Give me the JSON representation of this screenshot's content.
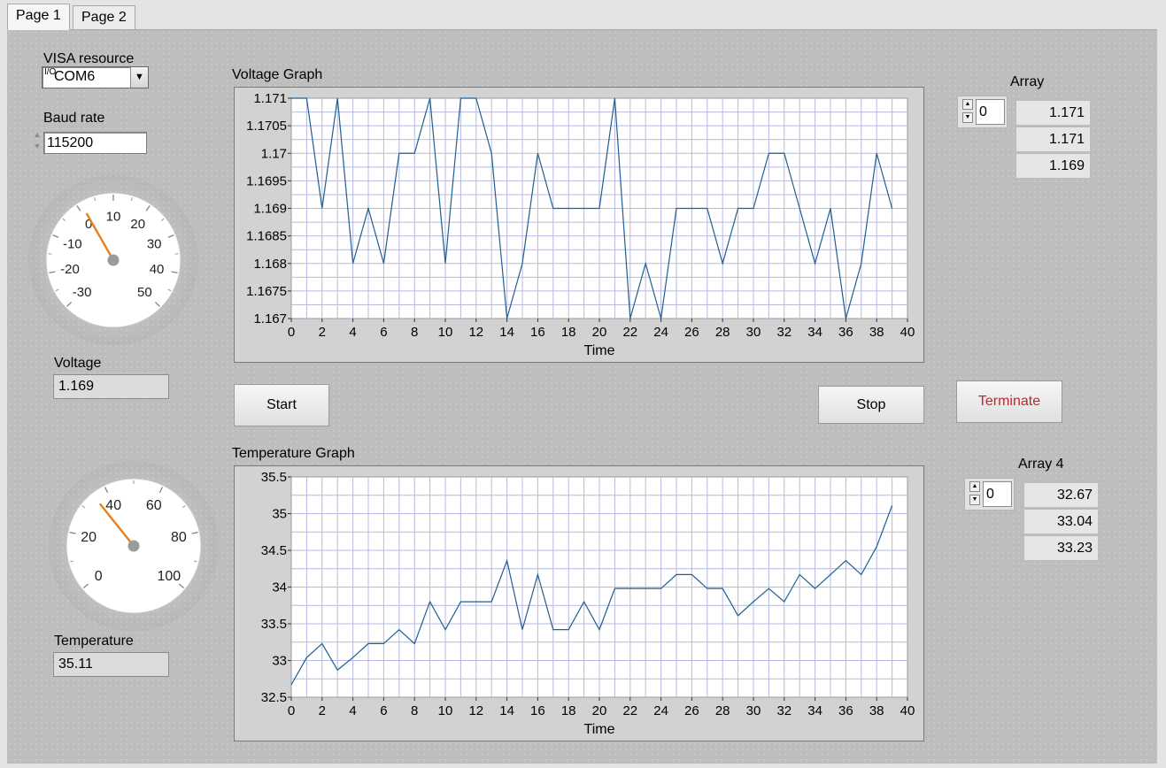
{
  "tabs": [
    {
      "label": "Page 1",
      "active": true
    },
    {
      "label": "Page 2",
      "active": false
    }
  ],
  "visa": {
    "label": "VISA resource",
    "value": "COM6",
    "glyph": "I/O"
  },
  "baud": {
    "label": "Baud rate",
    "value": "115200"
  },
  "voltage_gauge": {
    "ticks": [
      "-30",
      "-20",
      "-10",
      "0",
      "10",
      "20",
      "30",
      "40",
      "50"
    ],
    "value": 1.169,
    "needle_color": "#e8801a"
  },
  "voltage": {
    "label": "Voltage",
    "value": "1.169"
  },
  "temperature_gauge": {
    "ticks": [
      "0",
      "20",
      "40",
      "60",
      "80",
      "100"
    ],
    "value": 35.11,
    "needle_color": "#e8801a"
  },
  "temperature": {
    "label": "Temperature",
    "value": "35.11"
  },
  "buttons": {
    "start": "Start",
    "stop": "Stop",
    "terminate": "Terminate"
  },
  "array1": {
    "label": "Array",
    "index": "0",
    "values": [
      "1.171",
      "1.171",
      "1.169"
    ]
  },
  "array4": {
    "label": "Array 4",
    "index": "0",
    "values": [
      "32.67",
      "33.04",
      "33.23"
    ]
  },
  "colors": {
    "line": "#1f5f91",
    "grid": "#b8b8e0",
    "plot_bg": "#ffffff",
    "terminate_text": "#c0272d"
  },
  "chart_data": [
    {
      "type": "line",
      "title": "Voltage Graph",
      "xlabel": "Time",
      "ylabel": "",
      "xlim": [
        0,
        40
      ],
      "ylim": [
        1.167,
        1.171
      ],
      "xticks": [
        "0",
        "2",
        "4",
        "6",
        "8",
        "10",
        "12",
        "14",
        "16",
        "18",
        "20",
        "22",
        "24",
        "26",
        "28",
        "30",
        "32",
        "34",
        "36",
        "38",
        "40"
      ],
      "yticks": [
        "1.171",
        "1.1705",
        "1.17",
        "1.1695",
        "1.169",
        "1.1685",
        "1.168",
        "1.1675",
        "1.167"
      ],
      "grid": true,
      "x": [
        0,
        1,
        2,
        3,
        4,
        5,
        6,
        7,
        8,
        9,
        10,
        11,
        12,
        13,
        14,
        15,
        16,
        17,
        18,
        19,
        20,
        21,
        22,
        23,
        24,
        25,
        26,
        27,
        28,
        29,
        30,
        31,
        32,
        33,
        34,
        35,
        36,
        37,
        38,
        39
      ],
      "y": [
        1.171,
        1.171,
        1.169,
        1.171,
        1.168,
        1.169,
        1.168,
        1.17,
        1.17,
        1.171,
        1.168,
        1.171,
        1.171,
        1.17,
        1.167,
        1.168,
        1.17,
        1.169,
        1.169,
        1.169,
        1.169,
        1.171,
        1.167,
        1.168,
        1.167,
        1.169,
        1.169,
        1.169,
        1.168,
        1.169,
        1.169,
        1.17,
        1.17,
        1.169,
        1.168,
        1.169,
        1.167,
        1.168,
        1.17,
        1.169
      ]
    },
    {
      "type": "line",
      "title": "Temperature Graph",
      "xlabel": "Time",
      "ylabel": "",
      "xlim": [
        0,
        40
      ],
      "ylim": [
        32.5,
        35.5
      ],
      "xticks": [
        "0",
        "2",
        "4",
        "6",
        "8",
        "10",
        "12",
        "14",
        "16",
        "18",
        "20",
        "22",
        "24",
        "26",
        "28",
        "30",
        "32",
        "34",
        "36",
        "38",
        "40"
      ],
      "yticks": [
        "35.5",
        "35",
        "34.5",
        "34",
        "33.5",
        "33",
        "32.5"
      ],
      "grid": true,
      "x": [
        0,
        1,
        2,
        3,
        4,
        5,
        6,
        7,
        8,
        9,
        10,
        11,
        12,
        13,
        14,
        15,
        16,
        17,
        18,
        19,
        20,
        21,
        22,
        23,
        24,
        25,
        26,
        27,
        28,
        29,
        30,
        31,
        32,
        33,
        34,
        35,
        36,
        37,
        38,
        39
      ],
      "y": [
        32.67,
        33.04,
        33.23,
        32.87,
        33.04,
        33.23,
        33.23,
        33.42,
        33.23,
        33.8,
        33.42,
        33.8,
        33.8,
        33.8,
        34.36,
        33.42,
        34.17,
        33.42,
        33.42,
        33.8,
        33.42,
        33.98,
        33.98,
        33.98,
        33.98,
        34.17,
        34.17,
        33.98,
        33.98,
        33.61,
        33.8,
        33.98,
        33.8,
        34.17,
        33.98,
        34.17,
        34.36,
        34.17,
        34.55,
        35.11
      ]
    }
  ]
}
